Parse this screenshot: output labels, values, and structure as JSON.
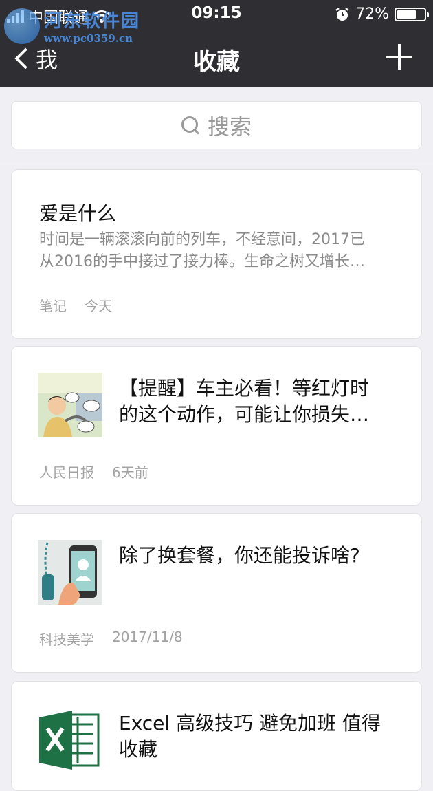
{
  "status_bar": {
    "carrier": "中国联通",
    "time": "09:15",
    "battery_percent_label": "72%",
    "battery_level": 0.72
  },
  "watermark": {
    "site_name": "河东软件园",
    "url": "www.pc0359.cn"
  },
  "nav": {
    "back_label": "我",
    "title": "收藏",
    "add_icon": "plus-icon"
  },
  "search": {
    "placeholder": "搜索",
    "icon": "search-icon"
  },
  "items": [
    {
      "type": "note",
      "title": "爱是什么",
      "excerpt_line1": "时间是一辆滚滚向前的列车，不经意间，2017已",
      "excerpt_line2": "从2016的手中接过了接力棒。生命之树又增长…",
      "source": "笔记",
      "date": "今天"
    },
    {
      "type": "article",
      "title_line1": "【提醒】车主必看！等红灯时",
      "title_line2": "的这个动作，可能让你损失…",
      "source": "人民日报",
      "date": "6天前",
      "thumb_icon": "driver-cartoon-thumbnail"
    },
    {
      "type": "article",
      "title_line1": "除了换套餐，你还能投诉啥?",
      "title_line2": "",
      "source": "科技美学",
      "date": "2017/11/8",
      "thumb_icon": "phone-call-thumbnail"
    },
    {
      "type": "article",
      "title_line1": "Excel 高级技巧 避免加班 值得",
      "title_line2": "收藏",
      "source": "",
      "date": "",
      "thumb_icon": "excel-logo-thumbnail"
    }
  ],
  "colors": {
    "header_bg": "#2e2e33",
    "page_bg": "#efeff4",
    "excel_green": "#1e7145"
  }
}
